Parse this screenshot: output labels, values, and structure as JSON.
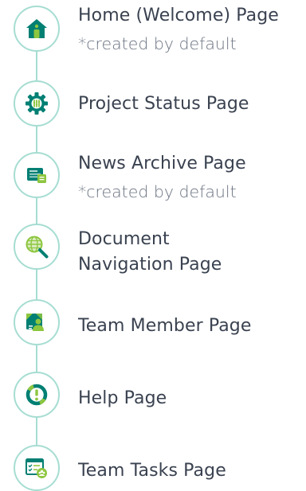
{
  "pages": [
    {
      "title": "Home (Welcome) Page",
      "subtitle": "*created by default",
      "icon": "home-icon"
    },
    {
      "title": "Project Status Page",
      "subtitle": "",
      "icon": "gear-icon"
    },
    {
      "title": "News Archive Page",
      "subtitle": "*created by default",
      "icon": "news-icon"
    },
    {
      "title": "Document Navigation Page",
      "subtitle": "",
      "icon": "globe-search-icon"
    },
    {
      "title": "Team Member Page",
      "subtitle": "",
      "icon": "team-member-icon"
    },
    {
      "title": "Help Page",
      "subtitle": "",
      "icon": "help-icon"
    },
    {
      "title": "Team Tasks Page",
      "subtitle": "",
      "icon": "tasks-icon"
    }
  ],
  "colors": {
    "teal": "#007f73",
    "green": "#8dc63f",
    "line": "#a6ddd2",
    "text": "#3a4250",
    "subtext": "#6a7280"
  }
}
